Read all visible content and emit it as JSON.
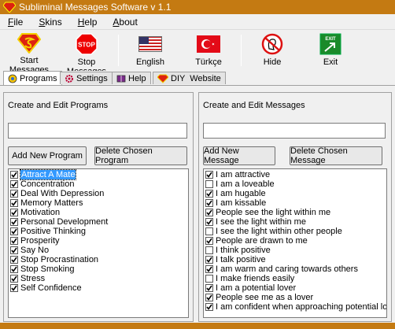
{
  "window": {
    "title": "Subliminal Messages Software v 1.1"
  },
  "menu": [
    "File",
    "Skins",
    "Help",
    "About"
  ],
  "toolbar": {
    "start": "Start Messages",
    "stop": "Stop Messages",
    "english": "English",
    "turkce": "Türkçe",
    "hide": "Hide",
    "exit": "Exit",
    "stop_icon_text": "STOP",
    "exit_icon_text": "EXIT"
  },
  "tabs": [
    "Programs",
    "Settings",
    "Help",
    "DIY  Website"
  ],
  "programs_panel": {
    "title": "Create and Edit Programs",
    "input_value": "",
    "add_button": "Add New Program",
    "delete_button": "Delete Chosen Program",
    "items": [
      {
        "label": "Attract A Mate",
        "checked": true,
        "selected": true
      },
      {
        "label": "Concentration",
        "checked": true
      },
      {
        "label": "Deal With Depression",
        "checked": true
      },
      {
        "label": "Memory Matters",
        "checked": true
      },
      {
        "label": "Motivation",
        "checked": true
      },
      {
        "label": "Personal Development",
        "checked": true
      },
      {
        "label": "Positive Thinking",
        "checked": true
      },
      {
        "label": "Prosperity",
        "checked": true
      },
      {
        "label": "Say No",
        "checked": true
      },
      {
        "label": "Stop Procrastination",
        "checked": true
      },
      {
        "label": "Stop Smoking",
        "checked": true
      },
      {
        "label": "Stress",
        "checked": true
      },
      {
        "label": "Self Confidence",
        "checked": true
      }
    ]
  },
  "messages_panel": {
    "title": "Create and Edit Messages",
    "input_value": "",
    "add_button": "Add New Message",
    "delete_button": "Delete Chosen Message",
    "items": [
      {
        "label": "I am attractive",
        "checked": true
      },
      {
        "label": "I am a loveable",
        "checked": false
      },
      {
        "label": "I am hugable",
        "checked": true
      },
      {
        "label": "I am kissable",
        "checked": true
      },
      {
        "label": "People see the light within me",
        "checked": true
      },
      {
        "label": "I see the light within me",
        "checked": true
      },
      {
        "label": "I see the light within other people",
        "checked": false
      },
      {
        "label": "People are drawn to me",
        "checked": true
      },
      {
        "label": "I think positive",
        "checked": false
      },
      {
        "label": "I talk positive",
        "checked": true
      },
      {
        "label": "I am warm and caring towards others",
        "checked": true
      },
      {
        "label": "I make friends easily",
        "checked": false
      },
      {
        "label": "I am a potential lover",
        "checked": true
      },
      {
        "label": "People see me as a lover",
        "checked": true
      },
      {
        "label": "I am confident when approaching potential lover",
        "checked": true
      }
    ]
  },
  "colors": {
    "titlebar": "#c47a12",
    "selection": "#3399ff"
  }
}
